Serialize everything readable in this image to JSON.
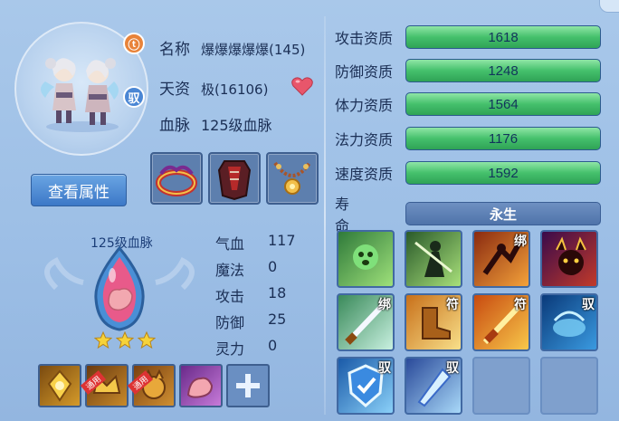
{
  "pet": {
    "name_label": "名称",
    "name_value": "爆爆爆爆爆(145)",
    "talent_label": "天资",
    "talent_value": "极(16106)",
    "bloodline_label": "血脉",
    "bloodline_value": "125级血脉",
    "badge_top": "ⓣ",
    "badge_mount": "驭"
  },
  "view_attr_button": "查看属性",
  "equipment": [
    {
      "name": "crown-equipment-icon"
    },
    {
      "name": "armor-equipment-icon"
    },
    {
      "name": "necklace-equipment-icon"
    }
  ],
  "bloodline": {
    "title": "125级血脉",
    "stars": 3,
    "stats": [
      {
        "label": "气血",
        "value": "117"
      },
      {
        "label": "魔法",
        "value": "0"
      },
      {
        "label": "攻击",
        "value": "18"
      },
      {
        "label": "防御",
        "value": "25"
      },
      {
        "label": "灵力",
        "value": "0"
      }
    ],
    "skill_slots": [
      {
        "name": "gold-rune-skill-icon",
        "tag": ""
      },
      {
        "name": "crown-rune-skill-icon",
        "tag": "通用"
      },
      {
        "name": "beast-rune-skill-icon",
        "tag": "通用"
      },
      {
        "name": "muscle-rune-skill-icon",
        "tag": ""
      }
    ]
  },
  "aptitudes": [
    {
      "label": "攻击资质",
      "value": "1618",
      "fill": 1.0
    },
    {
      "label": "防御资质",
      "value": "1248",
      "fill": 1.0
    },
    {
      "label": "体力资质",
      "value": "1564",
      "fill": 1.0
    },
    {
      "label": "法力资质",
      "value": "1176",
      "fill": 1.0
    },
    {
      "label": "速度资质",
      "value": "1592",
      "fill": 1.0
    }
  ],
  "lifespan": {
    "label": "寿 命",
    "value": "永生"
  },
  "skills": [
    {
      "name": "green-ghost-skill-icon",
      "tag": ""
    },
    {
      "name": "shadow-warrior-skill-icon",
      "tag": ""
    },
    {
      "name": "fire-kick-skill-icon",
      "tag": "绑"
    },
    {
      "name": "demon-lord-skill-icon",
      "tag": ""
    },
    {
      "name": "sword-slash-skill-icon",
      "tag": "绑"
    },
    {
      "name": "speed-boots-skill-icon",
      "tag": "符"
    },
    {
      "name": "fire-blade-skill-icon",
      "tag": "符"
    },
    {
      "name": "water-beast-skill-icon",
      "tag": "驭"
    },
    {
      "name": "shield-skill-icon",
      "tag": "驭"
    },
    {
      "name": "ice-blade-skill-icon",
      "tag": "驭"
    },
    {
      "name": "",
      "tag": ""
    },
    {
      "name": "",
      "tag": ""
    }
  ],
  "colors": {
    "bar_fill": "#45c06c",
    "bar_bg": "#3a6ea6",
    "button": "#3c78c7",
    "badge_orange": "#e8833a",
    "badge_blue": "#4a86d4"
  }
}
